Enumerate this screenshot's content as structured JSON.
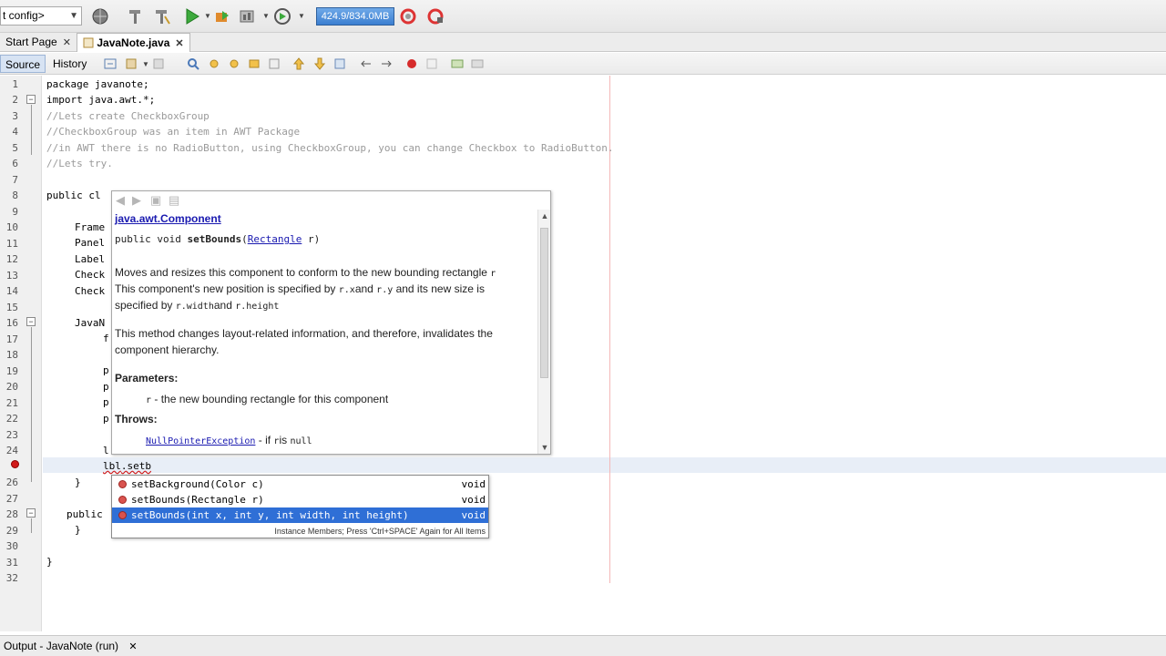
{
  "toolbar": {
    "config_value": "t config>",
    "memory": "424.9/834.0MB"
  },
  "tabs": [
    {
      "label": "Start Page"
    },
    {
      "label": "JavaNote.java"
    }
  ],
  "source_bar": {
    "source_label": "Source",
    "history_label": "History"
  },
  "editor": {
    "line_numbers": [
      "1",
      "2",
      "3",
      "4",
      "5",
      "6",
      "7",
      "8",
      "9",
      "10",
      "11",
      "12",
      "13",
      "14",
      "15",
      "16",
      "17",
      "18",
      "19",
      "20",
      "21",
      "22",
      "23",
      "24",
      "",
      "26",
      "27",
      "28",
      "29",
      "30",
      "31",
      "32"
    ],
    "lines": {
      "l1": "package javanote;",
      "l2": "import java.awt.*;",
      "l3": "//Lets create CheckboxGroup",
      "l4": "//CheckboxGroup was an item in AWT Package",
      "l5": "//in AWT there is no RadioButton, using CheckboxGroup, you can change Checkbox to RadioButton.",
      "l6": "//Lets try.",
      "l8": "public cl",
      "l10": "Frame",
      "l11": "Panel",
      "l12": "Label",
      "l13": "Check",
      "l14": "Check",
      "l16": "JavaN",
      "l17": "f",
      "l19": "p",
      "l20": "p",
      "l21": "p",
      "l22": "p",
      "l24": "l",
      "l25_obj": "lbl",
      "l25_rest": ".setb",
      "l26": "}",
      "l28": "public",
      "l29": "}",
      "l31": "}"
    }
  },
  "javadoc": {
    "class_name": "java.awt.Component",
    "signature_prefix": "public void ",
    "method_name": "setBounds",
    "param_type": "Rectangle",
    "param_name": " r)",
    "paren_open": "(",
    "desc1_a": "Moves and resizes this component to conform to the new bounding rectangle ",
    "desc1_code": "r",
    "desc2_a": "This component's new position is specified by ",
    "desc2_code1": "r.x",
    "desc2_b": "and ",
    "desc2_code2": "r.y",
    "desc2_c": " and its new size is",
    "desc3_a": "specified by ",
    "desc3_code1": "r.width",
    "desc3_b": "and ",
    "desc3_code2": "r.height",
    "desc4": "This method changes layout-related information, and therefore, invalidates the",
    "desc5": "component hierarchy.",
    "params_heading": "Parameters:",
    "param_code": "r",
    "param_desc": " - the new bounding rectangle for this component",
    "throws_heading": "Throws:",
    "exception": "NullPointerException",
    "exception_a": " - if ",
    "exception_code1": "r",
    "exception_b": "is ",
    "exception_code2": "null"
  },
  "completion": {
    "items": [
      {
        "label": "setBackground(Color c)",
        "type": "void"
      },
      {
        "label": "setBounds(Rectangle r)",
        "type": "void"
      },
      {
        "label": "setBounds(int x, int y, int width, int height)",
        "type": "void"
      }
    ],
    "footer": "Instance Members; Press 'Ctrl+SPACE' Again for All Items"
  },
  "output": {
    "tab_label": "Output - JavaNote (run)"
  },
  "colors": {
    "selection": "#2f6fd6",
    "comment": "#9a9a9a",
    "error": "#d11a1a",
    "link": "#1a1ab0"
  }
}
